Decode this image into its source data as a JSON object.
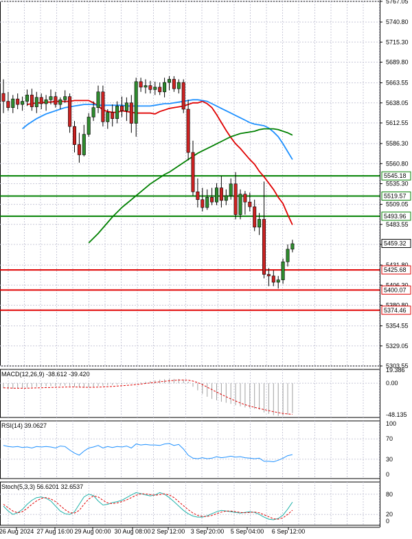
{
  "chart_data": [
    {
      "panel": "price",
      "type": "candlestick",
      "y_ticks": [
        5767.05,
        5740.8,
        5715.3,
        5689.8,
        5663.55,
        5638.05,
        5612.55,
        5586.3,
        5560.8,
        5535.3,
        5509.05,
        5483.55,
        5458.05,
        5431.8,
        5406.3,
        5380.8,
        5354.55,
        5329.05,
        5303.55
      ],
      "ylim": [
        5303.55,
        5767.05
      ],
      "x_labels": [
        "26 Aug 2024",
        "27 Aug 16:00",
        "29 Aug 00:00",
        "30 Aug 08:00",
        "2 Sep 12:00",
        "3 Sep 20:00",
        "5 Sep 04:00",
        "6 Sep 12:00"
      ],
      "last_price": "5459.32",
      "candles": [
        [
          5650,
          5668,
          5625,
          5640
        ],
        [
          5640,
          5652,
          5628,
          5632
        ],
        [
          5632,
          5648,
          5625,
          5643
        ],
        [
          5643,
          5650,
          5630,
          5636
        ],
        [
          5636,
          5646,
          5628,
          5640
        ],
        [
          5640,
          5655,
          5634,
          5648
        ],
        [
          5648,
          5656,
          5628,
          5633
        ],
        [
          5633,
          5652,
          5625,
          5645
        ],
        [
          5645,
          5650,
          5630,
          5637
        ],
        [
          5637,
          5648,
          5628,
          5642
        ],
        [
          5642,
          5655,
          5636,
          5646
        ],
        [
          5646,
          5652,
          5632,
          5636
        ],
        [
          5636,
          5645,
          5630,
          5642
        ],
        [
          5642,
          5654,
          5638,
          5646
        ],
        [
          5646,
          5650,
          5600,
          5608
        ],
        [
          5608,
          5615,
          5575,
          5585
        ],
        [
          5585,
          5600,
          5562,
          5572
        ],
        [
          5572,
          5610,
          5570,
          5598
        ],
        [
          5598,
          5625,
          5595,
          5620
        ],
        [
          5620,
          5640,
          5615,
          5632
        ],
        [
          5632,
          5660,
          5625,
          5652
        ],
        [
          5652,
          5660,
          5608,
          5614
        ],
        [
          5614,
          5630,
          5605,
          5626
        ],
        [
          5626,
          5636,
          5608,
          5618
        ],
        [
          5618,
          5640,
          5612,
          5634
        ],
        [
          5634,
          5646,
          5620,
          5628
        ],
        [
          5628,
          5645,
          5615,
          5638
        ],
        [
          5638,
          5648,
          5600,
          5612
        ],
        [
          5612,
          5670,
          5595,
          5665
        ],
        [
          5665,
          5670,
          5652,
          5658
        ],
        [
          5658,
          5668,
          5650,
          5660
        ],
        [
          5660,
          5666,
          5650,
          5655
        ],
        [
          5655,
          5665,
          5648,
          5658
        ],
        [
          5658,
          5664,
          5648,
          5652
        ],
        [
          5652,
          5670,
          5645,
          5664
        ],
        [
          5664,
          5672,
          5654,
          5668
        ],
        [
          5668,
          5672,
          5652,
          5656
        ],
        [
          5656,
          5668,
          5650,
          5664
        ],
        [
          5664,
          5668,
          5625,
          5630
        ],
        [
          5630,
          5642,
          5565,
          5575
        ],
        [
          5575,
          5590,
          5520,
          5525
        ],
        [
          5525,
          5542,
          5505,
          5515
        ],
        [
          5515,
          5530,
          5500,
          5505
        ],
        [
          5505,
          5528,
          5502,
          5518
        ],
        [
          5518,
          5530,
          5508,
          5512
        ],
        [
          5512,
          5536,
          5508,
          5530
        ],
        [
          5530,
          5545,
          5505,
          5514
        ],
        [
          5514,
          5528,
          5508,
          5520
        ],
        [
          5520,
          5542,
          5515,
          5535
        ],
        [
          5535,
          5550,
          5490,
          5496
        ],
        [
          5496,
          5528,
          5490,
          5522
        ],
        [
          5522,
          5526,
          5496,
          5512
        ],
        [
          5512,
          5524,
          5500,
          5506
        ],
        [
          5506,
          5515,
          5475,
          5480
        ],
        [
          5480,
          5498,
          5470,
          5490
        ],
        [
          5490,
          5538,
          5415,
          5420
        ],
        [
          5420,
          5428,
          5405,
          5418
        ],
        [
          5418,
          5425,
          5405,
          5410
        ],
        [
          5410,
          5418,
          5402,
          5413
        ],
        [
          5413,
          5440,
          5408,
          5436
        ],
        [
          5436,
          5458,
          5430,
          5452
        ],
        [
          5452,
          5464,
          5448,
          5459
        ]
      ],
      "series": [
        {
          "name": "",
          "color": "#e00000",
          "values": [
            5636,
            5637,
            5638,
            5638,
            5639,
            5639,
            5640,
            5640,
            5640,
            5640,
            5641,
            5641,
            5641,
            5641,
            5638,
            5634,
            5629,
            5627,
            5626,
            5626,
            5628,
            5627,
            5626,
            5625,
            5625,
            5625,
            5625,
            5624,
            5627,
            5629,
            5631,
            5632,
            5633,
            5634,
            5636,
            5638,
            5638,
            5640,
            5637,
            5632,
            5623,
            5613,
            5603,
            5594,
            5586,
            5580,
            5573,
            5566,
            5560,
            5551,
            5544,
            5536,
            5528,
            5518,
            5510,
            5496,
            5483
          ]
        },
        {
          "name": "",
          "color": "#1e90ff",
          "values": [
            5605,
            5610,
            5614,
            5618,
            5621,
            5624,
            5626,
            5628,
            5630,
            5632,
            5633,
            5634,
            5635,
            5636,
            5636,
            5636,
            5635,
            5635,
            5635,
            5635,
            5635,
            5635,
            5634,
            5634,
            5634,
            5634,
            5634,
            5634,
            5635,
            5636,
            5637,
            5637,
            5638,
            5639,
            5640,
            5641,
            5642,
            5642,
            5641,
            5640,
            5637,
            5634,
            5631,
            5628,
            5625,
            5622,
            5619,
            5616,
            5613,
            5611,
            5610,
            5609,
            5606,
            5601,
            5595,
            5586,
            5576,
            5566
          ]
        },
        {
          "name": "",
          "color": "#008000",
          "values": [
            5460,
            5466,
            5472,
            5479,
            5486,
            5493,
            5499,
            5505,
            5510,
            5515,
            5520,
            5525,
            5530,
            5535,
            5539,
            5543,
            5547,
            5550,
            5554,
            5558,
            5562,
            5566,
            5570,
            5574,
            5577,
            5580,
            5583,
            5586,
            5589,
            5592,
            5595,
            5597,
            5599,
            5600,
            5601,
            5602,
            5604,
            5605,
            5605,
            5605,
            5604,
            5602,
            5600,
            5597
          ]
        }
      ],
      "levels": [
        {
          "value": "5545.18",
          "color": "#008000"
        },
        {
          "value": "5519.57",
          "color": "#008000"
        },
        {
          "value": "5493.96",
          "color": "#008000"
        },
        {
          "value": "5425.68",
          "color": "#e00000"
        },
        {
          "value": "5400.07",
          "color": "#e00000"
        },
        {
          "value": "5374.46",
          "color": "#e00000"
        }
      ]
    },
    {
      "panel": "macd",
      "type": "histogram+line",
      "label": "MACD(12,26,9) -38.612 -39.420",
      "y_ticks": [
        "19.386",
        "0.00",
        "-48.135"
      ],
      "ylim": [
        -48.135,
        19.386
      ],
      "histogram": [
        -7,
        -7.5,
        -7.5,
        -7,
        -6.5,
        -6,
        -5.5,
        -5,
        -4.5,
        -4.5,
        -4,
        -4,
        -3.5,
        -3.5,
        -4,
        -5,
        -6,
        -6.5,
        -6,
        -5,
        -4,
        -3.5,
        -3,
        -2.5,
        -2,
        -1.5,
        -1,
        -0.5,
        0,
        1,
        2,
        3,
        4,
        5,
        5.5,
        6,
        6,
        6,
        5,
        2,
        -5,
        -10,
        -15,
        -19,
        -22,
        -24,
        -26,
        -27.5,
        -29,
        -31,
        -32.5,
        -34,
        -35,
        -36,
        -37,
        -41,
        -43,
        -45,
        -46,
        -45.5,
        -44,
        -42
      ],
      "signal": [
        -6.5,
        -6.7,
        -6.9,
        -7,
        -7,
        -6.9,
        -6.8,
        -6.6,
        -6.4,
        -6.2,
        -6,
        -5.8,
        -5.6,
        -5.4,
        -5.3,
        -5.3,
        -5.5,
        -5.7,
        -5.8,
        -5.7,
        -5.5,
        -5.2,
        -4.9,
        -4.5,
        -4.1,
        -3.6,
        -3.1,
        -2.5,
        -1.9,
        -1.2,
        -0.4,
        0.4,
        1.2,
        2,
        2.8,
        3.4,
        4,
        4.4,
        4.5,
        4.2,
        3,
        1,
        -2,
        -5.5,
        -9,
        -12.5,
        -15.8,
        -19,
        -22,
        -25,
        -27.8,
        -30.2,
        -32.2,
        -34,
        -35.5,
        -37,
        -38.5,
        -40,
        -41.3,
        -42.4,
        -43.2,
        -43.8
      ]
    },
    {
      "panel": "rsi",
      "type": "line",
      "label": "RSI(14) 39.0627",
      "y_ticks": [
        "100",
        "70",
        "30",
        "0"
      ],
      "ylim": [
        0,
        100
      ],
      "levels": [
        70,
        30
      ],
      "values": [
        57,
        55,
        54,
        55,
        53,
        54,
        52,
        55,
        54,
        55,
        54,
        52,
        56,
        55,
        48,
        42,
        38,
        46,
        52,
        54,
        57,
        52,
        55,
        53,
        55,
        54,
        56,
        52,
        60,
        58,
        59,
        58,
        58,
        57,
        60,
        61,
        57,
        59,
        50,
        38,
        32,
        31,
        33,
        31,
        32,
        35,
        33,
        34,
        36,
        34,
        35,
        33,
        32,
        31,
        32,
        26,
        26,
        25,
        28,
        32,
        37,
        39
      ]
    },
    {
      "panel": "stoch",
      "type": "line",
      "label": "Stoch(5,3,3) 56.6201 32.6537",
      "y_ticks": [
        "80",
        "20",
        "0"
      ],
      "ylim": [
        0,
        100
      ],
      "levels": [
        80,
        20
      ],
      "main": [
        45,
        30,
        20,
        25,
        35,
        50,
        62,
        70,
        72,
        68,
        60,
        45,
        30,
        22,
        20,
        28,
        50,
        72,
        80,
        76,
        60,
        48,
        50,
        55,
        58,
        62,
        70,
        78,
        85,
        82,
        78,
        75,
        78,
        85,
        80,
        70,
        58,
        45,
        32,
        22,
        15,
        12,
        12,
        16,
        22,
        28,
        32,
        30,
        28,
        26,
        24,
        26,
        28,
        26,
        20,
        12,
        6,
        4,
        8,
        18,
        36,
        56.6
      ],
      "signal": [
        50,
        40,
        30,
        25,
        28,
        38,
        50,
        60,
        68,
        70,
        66,
        58,
        46,
        34,
        25,
        24,
        32,
        50,
        66,
        75,
        72,
        62,
        54,
        52,
        54,
        58,
        63,
        70,
        77,
        81,
        81,
        79,
        77,
        79,
        81,
        78,
        70,
        58,
        46,
        34,
        24,
        17,
        14,
        14,
        17,
        22,
        27,
        30,
        30,
        28,
        26,
        25,
        26,
        27,
        25,
        19,
        13,
        7,
        6,
        10,
        20,
        32.7
      ]
    }
  ]
}
